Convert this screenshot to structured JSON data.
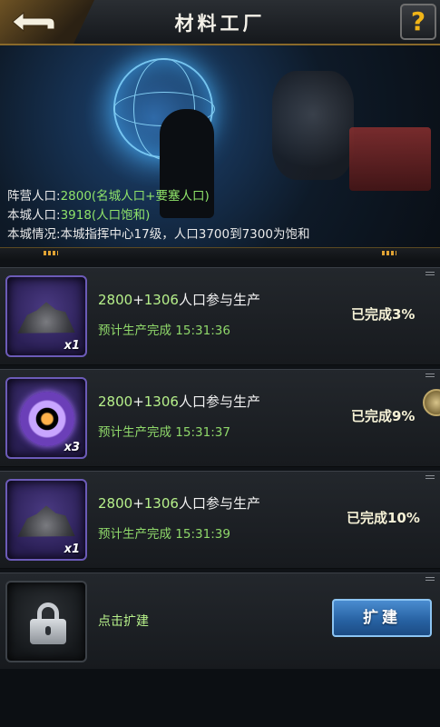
{
  "header": {
    "title": "材料工厂",
    "help_label": "?"
  },
  "banner": {
    "lines": [
      {
        "label": "阵营人口:",
        "value": "2800(名城人口+要塞人口)"
      },
      {
        "label": "本城人口:",
        "value": "3918(人口饱和)"
      },
      {
        "label": "本城情况:本城指挥中心17级，人口3700到7300为饱和",
        "value": ""
      }
    ]
  },
  "slots": [
    {
      "icon": "ore-icon",
      "qty": "x1",
      "population_a": "2800",
      "population_b": "1306",
      "population_suffix": "人口参与生产",
      "eta_label": "预计生产完成",
      "eta_time": "15:31:36",
      "status": "已完成3%",
      "progress_percent": 3
    },
    {
      "icon": "core-component-icon",
      "qty": "x3",
      "population_a": "2800",
      "population_b": "1306",
      "population_suffix": "人口参与生产",
      "eta_label": "预计生产完成",
      "eta_time": "15:31:37",
      "status": "已完成9%",
      "progress_percent": 9
    },
    {
      "icon": "ore-icon",
      "qty": "x1",
      "population_a": "2800",
      "population_b": "1306",
      "population_suffix": "人口参与生产",
      "eta_label": "预计生产完成",
      "eta_time": "15:31:39",
      "status": "已完成10%",
      "progress_percent": 10
    }
  ],
  "locked_slot": {
    "hint": "点击扩建",
    "button_label": "扩建"
  }
}
